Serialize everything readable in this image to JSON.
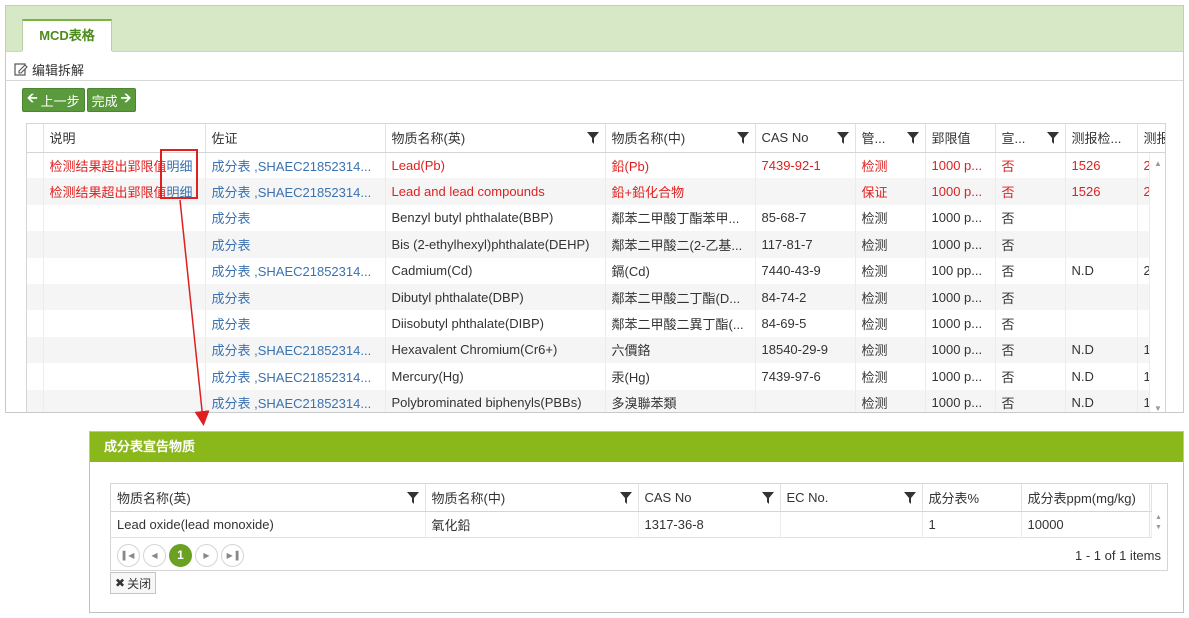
{
  "tab": {
    "label": "MCD表格"
  },
  "edit": {
    "label": "编辑拆解"
  },
  "buttons": {
    "prev": "上一步",
    "finish": "完成"
  },
  "grid": {
    "columns": [
      "说明",
      "佐证",
      "物质名称(英)",
      "物质名称(中)",
      "CAS No",
      "管...",
      "郢限值",
      "宣...",
      "测报检...",
      "测报"
    ],
    "rows": [
      {
        "note": "检测结果超出郢限值",
        "detail": "明细",
        "proof": "成分表 ,SHAEC21852314...",
        "en": "Lead(Pb)",
        "cn": "鉛(Pb)",
        "cas": "7439-92-1",
        "mgmt": "检测",
        "limit": "1000 p...",
        "decl": "否",
        "test": "1526",
        "rep": "2",
        "red": true
      },
      {
        "note": "检测结果超出郢限值",
        "detail": "明细",
        "proof": "成分表 ,SHAEC21852314...",
        "en": "Lead and lead compounds",
        "cn": "鉛+鉛化合物",
        "cas": "",
        "mgmt": "保证",
        "limit": "1000 p...",
        "decl": "否",
        "test": "1526",
        "rep": "2",
        "red": true
      },
      {
        "note": "",
        "detail": "",
        "proof": "成分表",
        "en": "Benzyl butyl phthalate(BBP)",
        "cn": "鄰苯二甲酸丁酯苯甲...",
        "cas": "85-68-7",
        "mgmt": "检测",
        "limit": "1000 p...",
        "decl": "否",
        "test": "",
        "rep": "",
        "red": false
      },
      {
        "note": "",
        "detail": "",
        "proof": "成分表",
        "en": "Bis (2-ethylhexyl)phthalate(DEHP)",
        "cn": "鄰苯二甲酸二(2-乙基...",
        "cas": "117-81-7",
        "mgmt": "检测",
        "limit": "1000 p...",
        "decl": "否",
        "test": "",
        "rep": "",
        "red": false
      },
      {
        "note": "",
        "detail": "",
        "proof": "成分表 ,SHAEC21852314...",
        "en": "Cadmium(Cd)",
        "cn": "鎘(Cd)",
        "cas": "7440-43-9",
        "mgmt": "检测",
        "limit": "100 pp...",
        "decl": "否",
        "test": "N.D",
        "rep": "2",
        "red": false
      },
      {
        "note": "",
        "detail": "",
        "proof": "成分表",
        "en": "Dibutyl phthalate(DBP)",
        "cn": "鄰苯二甲酸二丁酯(D...",
        "cas": "84-74-2",
        "mgmt": "检测",
        "limit": "1000 p...",
        "decl": "否",
        "test": "",
        "rep": "",
        "red": false
      },
      {
        "note": "",
        "detail": "",
        "proof": "成分表",
        "en": "Diisobutyl phthalate(DIBP)",
        "cn": "鄰苯二甲酸二異丁酯(...",
        "cas": "84-69-5",
        "mgmt": "检测",
        "limit": "1000 p...",
        "decl": "否",
        "test": "",
        "rep": "",
        "red": false
      },
      {
        "note": "",
        "detail": "",
        "proof": "成分表 ,SHAEC21852314...",
        "en": "Hexavalent Chromium(Cr6+)",
        "cn": "六價鉻",
        "cas": "18540-29-9",
        "mgmt": "检测",
        "limit": "1000 p...",
        "decl": "否",
        "test": "N.D",
        "rep": "1",
        "red": false
      },
      {
        "note": "",
        "detail": "",
        "proof": "成分表 ,SHAEC21852314...",
        "en": "Mercury(Hg)",
        "cn": "汞(Hg)",
        "cas": "7439-97-6",
        "mgmt": "检测",
        "limit": "1000 p...",
        "decl": "否",
        "test": "N.D",
        "rep": "1",
        "red": false
      },
      {
        "note": "",
        "detail": "",
        "proof": "成分表 ,SHAEC21852314...",
        "en": "Polybrominated biphenyls(PBBs)",
        "cn": "多溴聯苯類",
        "cas": "",
        "mgmt": "检测",
        "limit": "1000 p...",
        "decl": "否",
        "test": "N.D",
        "rep": "1",
        "red": false
      }
    ]
  },
  "popup": {
    "title": "成分表宣告物质",
    "columns": [
      "物质名称(英)",
      "物质名称(中)",
      "CAS No",
      "EC No.",
      "成分表%",
      "成分表ppm(mg/kg)"
    ],
    "rows": [
      {
        "en": "Lead oxide(lead monoxide)",
        "cn": "氧化鉛",
        "cas": "1317-36-8",
        "ec": "",
        "pct": "1",
        "ppm": "10000"
      }
    ],
    "pager": {
      "page": "1",
      "info": "1 - 1 of 1 items"
    },
    "close_label": "关闭"
  },
  "colors": {
    "accent_green": "#8ab81a",
    "button_green": "#5a9a3c",
    "alert_red": "#e02020",
    "link_blue": "#3a72b0"
  }
}
